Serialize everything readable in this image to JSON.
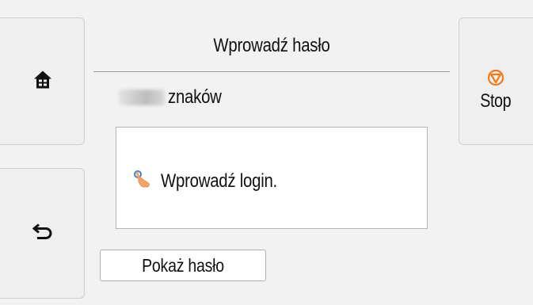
{
  "header": {
    "title": "Wprowadź hasło"
  },
  "password": {
    "char_count_label": "znaków"
  },
  "login_box": {
    "hint": "Wprowadź login."
  },
  "buttons": {
    "home_icon": "home-icon",
    "back_icon": "back-arrow-icon",
    "stop_label": "Stop",
    "stop_icon": "stop-icon",
    "show_password_label": "Pokaż hasło"
  },
  "colors": {
    "stop_icon": "#f07a1c",
    "hint_icon_finger": "#f3a46a",
    "hint_icon_touch": "#3c7fd1"
  }
}
